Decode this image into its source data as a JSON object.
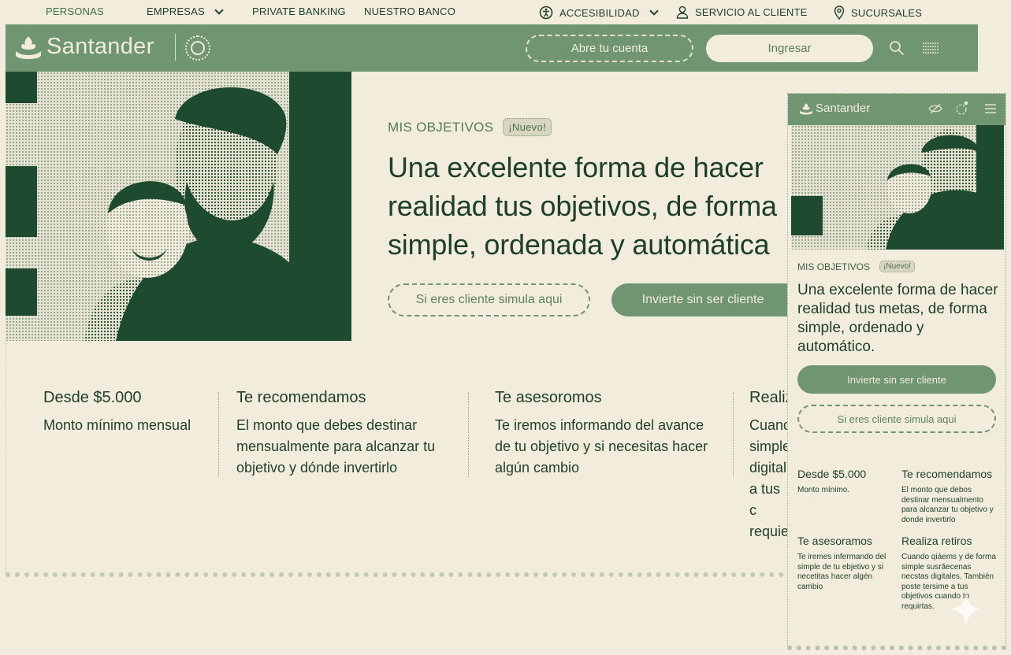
{
  "topnav": {
    "personas": "PERSONAS",
    "empresas": "EMPRESAS",
    "private_banking": "PRIVATE BANKING",
    "nuestro_banco": "NUESTRO BANCO",
    "accesibilidad": "ACCESIBILIDAD",
    "servicio": "SERVICIO AL CLIENTE",
    "sucursales": "SUCURSALES"
  },
  "header": {
    "brand": "Santander",
    "open_account": "Abre tu cuenta",
    "login": "Ingresar"
  },
  "hero": {
    "label": "MIS OBJETIVOS",
    "badge": "¡Nuevo!",
    "headline": "Una excelente forma de hacer realidad tus objetivos, de forma simple, ordenada y automática",
    "btn_client": "Si eres cliente simula aqui",
    "btn_nonclient": "Invierte sin ser cliente"
  },
  "features": [
    {
      "title": "Desde $5.000",
      "text": "Monto mínimo mensual"
    },
    {
      "title": "Te recomendamos",
      "text": "El monto que debes destinar mensualmente para alcanzar tu objetivo y dónde invertirlo"
    },
    {
      "title": "Te asesoromos",
      "text": "Te iremos informando del avance de tu objetivo y si necesitas hacer algún cambio"
    },
    {
      "title": "Realiz",
      "text": "Cuand simple digital a tus c requie"
    }
  ],
  "mobile": {
    "brand": "Santander",
    "label": "MIS OBJETIVOS",
    "badge": "¡Nuevo!",
    "headline": "Una excelente forma de hacer realidad tus metas, de forma simple, ordenado y automático.",
    "btn_nonclient": "Invierte sin ser cliente",
    "btn_client": "Si eres cliente simula aqui",
    "features": [
      {
        "title": "Desde $5.000",
        "text": "Monto mínimo."
      },
      {
        "title": "Te recomendamos",
        "text": "El monto que debos destinar mensualmento para alcanzar tu objetivo y donde invertirlo"
      },
      {
        "title": "Te asesoramos",
        "text": "Te iremes infermando del simple de tu ebjetivo y si necetitas hacer algén cambio"
      },
      {
        "title": "Realiza retiros",
        "text": "Cuando qiáems y de forma simple susrăecenas necstas digitales. También poste tersime a tus objetivos cuando to requirtas."
      }
    ]
  },
  "colors": {
    "brand_green": "#6f9670",
    "dark_green": "#1d3f2a",
    "paper": "#f2ecdc"
  }
}
